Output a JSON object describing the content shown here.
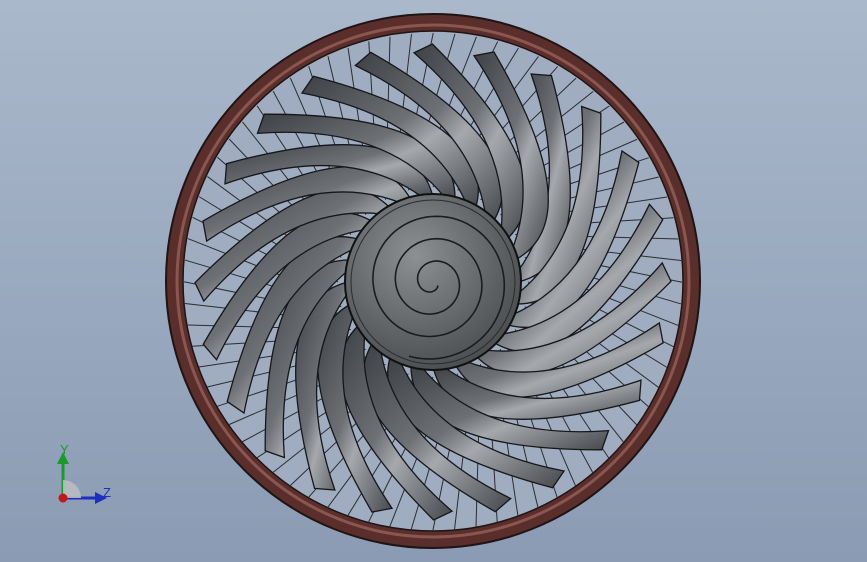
{
  "viewport": {
    "background_top": "#aab8cb",
    "background_bottom": "#8a9bb3"
  },
  "model": {
    "description_icon": "fan-impeller-icon",
    "blade_count": 24,
    "spoke_count": 72,
    "rim_color": "#6b3a35",
    "rim_inner_color": "#8a5650",
    "blade_color": "#55585c",
    "blade_highlight": "#9ea2a6",
    "hub_color": "#6a6d70",
    "spoke_color": "#2a2d33"
  },
  "triad": {
    "y_label": "Y",
    "z_label": "Z",
    "y_color": "#1a9a2a",
    "z_color": "#1c2fbf",
    "x_color": "#c41818"
  }
}
